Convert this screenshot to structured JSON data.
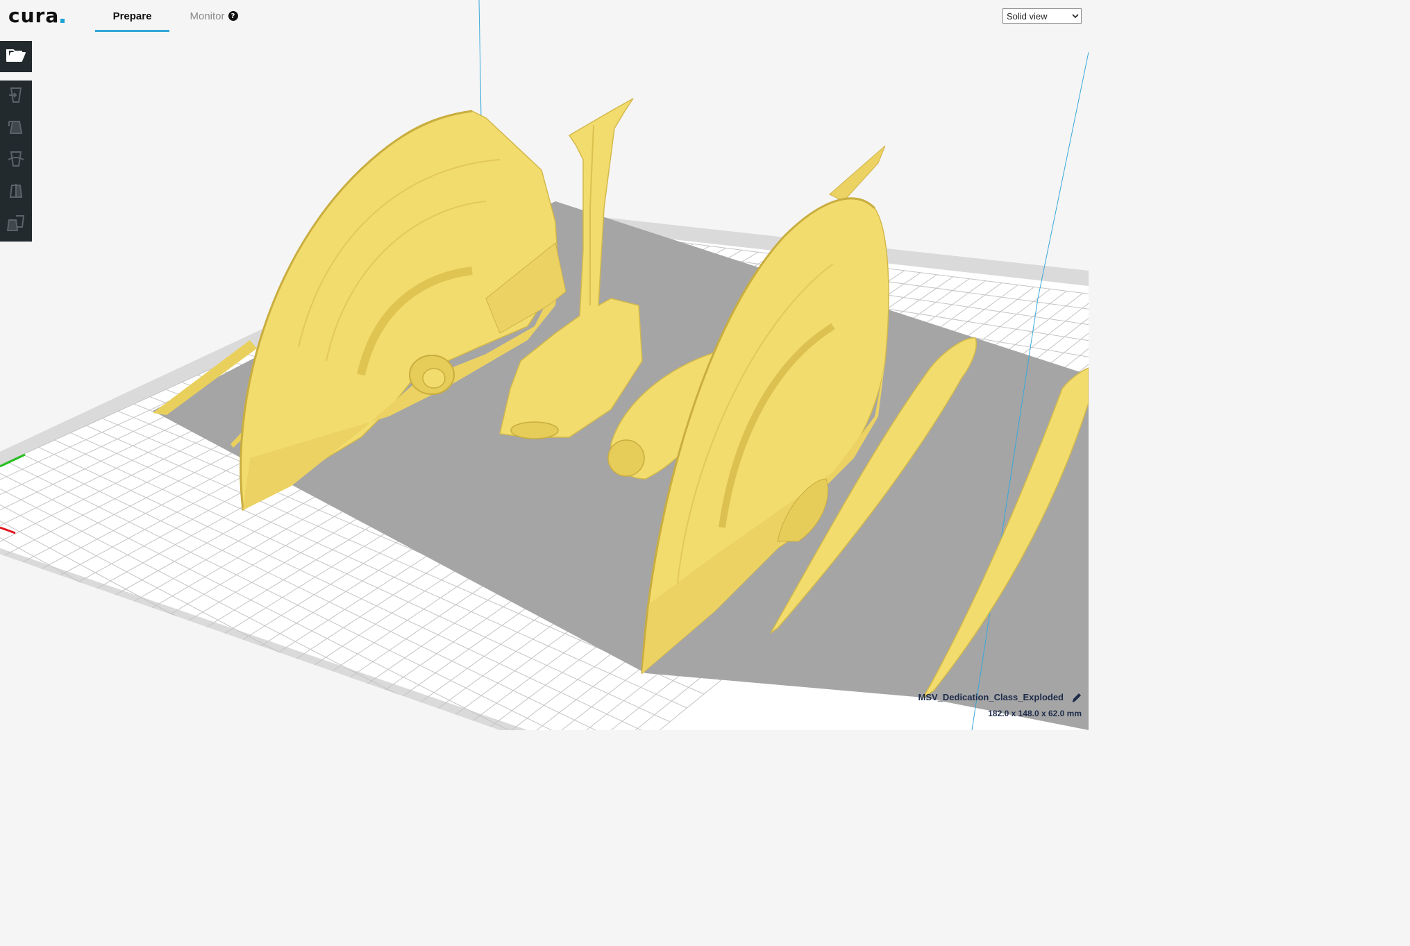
{
  "app": {
    "logo": "cura"
  },
  "header": {
    "tabs": [
      {
        "label": "Prepare",
        "active": true
      },
      {
        "label": "Monitor",
        "active": false
      }
    ],
    "help_glyph": "?"
  },
  "view_mode": {
    "selected": "Solid view"
  },
  "toolbar": {
    "open_icon": "folder-open-icon",
    "tools": [
      "move-tool-icon",
      "scale-tool-icon",
      "rotate-tool-icon",
      "mirror-tool-icon",
      "per-model-settings-icon"
    ]
  },
  "object": {
    "name": "MSV_Dedication_Class_Exploded",
    "dimensions": "182.0 x 148.0 x 62.0 mm"
  },
  "colors": {
    "model": "#f2dc6e",
    "model_shade": "#d9bf4d",
    "build_plate": "#ffffff",
    "build_plate_border": "#dadada",
    "shadow": "#a5a5a5",
    "accent": "#32a6d8",
    "toolbar": "#222a2e",
    "axis_x": "#e0141e",
    "axis_y": "#22c01b"
  }
}
